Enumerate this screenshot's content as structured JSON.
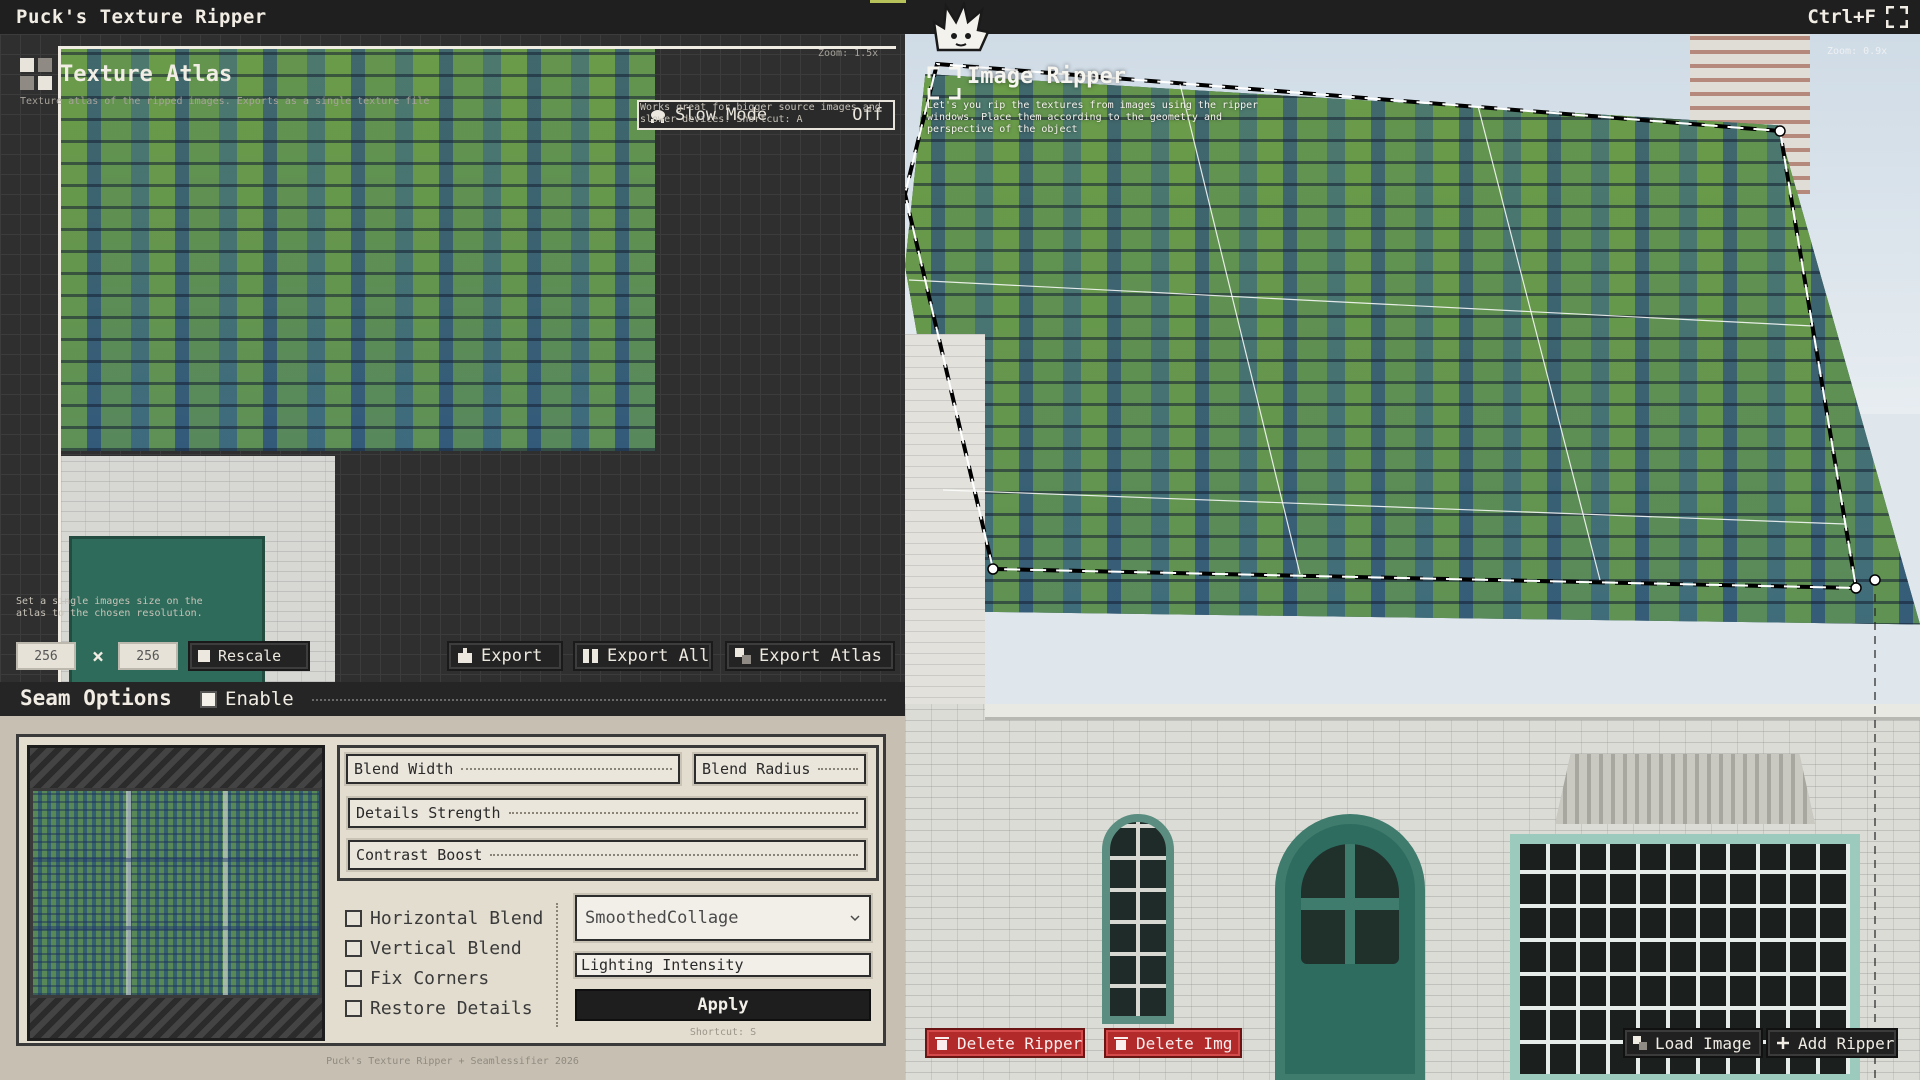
{
  "app": {
    "title": "Puck's Texture Ripper",
    "hotkey": "Ctrl+F"
  },
  "atlas": {
    "title": "Texture Atlas",
    "description": "Texture atlas of the ripped images. Exports as a single texture file",
    "zoom": "Zoom: 1.5x",
    "slow_mode": {
      "label": "Slow Mode",
      "value": "Off",
      "note": "Works great for bigger source images and slower devices! Shortcut: A"
    },
    "size_note": "Set a single images size on the atlas to the chosen resolution.",
    "width": "256",
    "height": "256",
    "times": "×",
    "rescale_label": "Rescale",
    "export_label": "Export",
    "export_all_label": "Export All",
    "export_atlas_label": "Export Atlas"
  },
  "seam": {
    "title": "Seam Options",
    "enable_label": "Enable",
    "sliders": {
      "blend_width": "Blend Width",
      "blend_radius": "Blend Radius",
      "details_strength": "Details Strength",
      "contrast_boost": "Contrast Boost"
    },
    "checks": {
      "horizontal": "Horizontal Blend",
      "vertical": "Vertical Blend",
      "fix_corners": "Fix Corners",
      "restore_details": "Restore Details"
    },
    "mode_selected": "SmoothedCollage",
    "lighting_label": "Lighting Intensity",
    "apply_label": "Apply",
    "shortcut": "Shortcut: S",
    "footer": "Puck's Texture Ripper + Seamlessifier 2026"
  },
  "ripper": {
    "title": "Image Ripper",
    "description": "Let's you rip the textures from images using the ripper windows. Place them according to the geometry and perspective of the object",
    "zoom": "Zoom: 0.9x",
    "delete_ripper_label": "Delete Ripper",
    "delete_img_label": "Delete Img",
    "load_image_label": "Load Image",
    "add_ripper_label": "Add Ripper"
  },
  "colors": {
    "accent": "#b7c25a",
    "danger": "#b22a2a",
    "panel": "#c7bfb1",
    "dark": "#1f1f1f"
  }
}
